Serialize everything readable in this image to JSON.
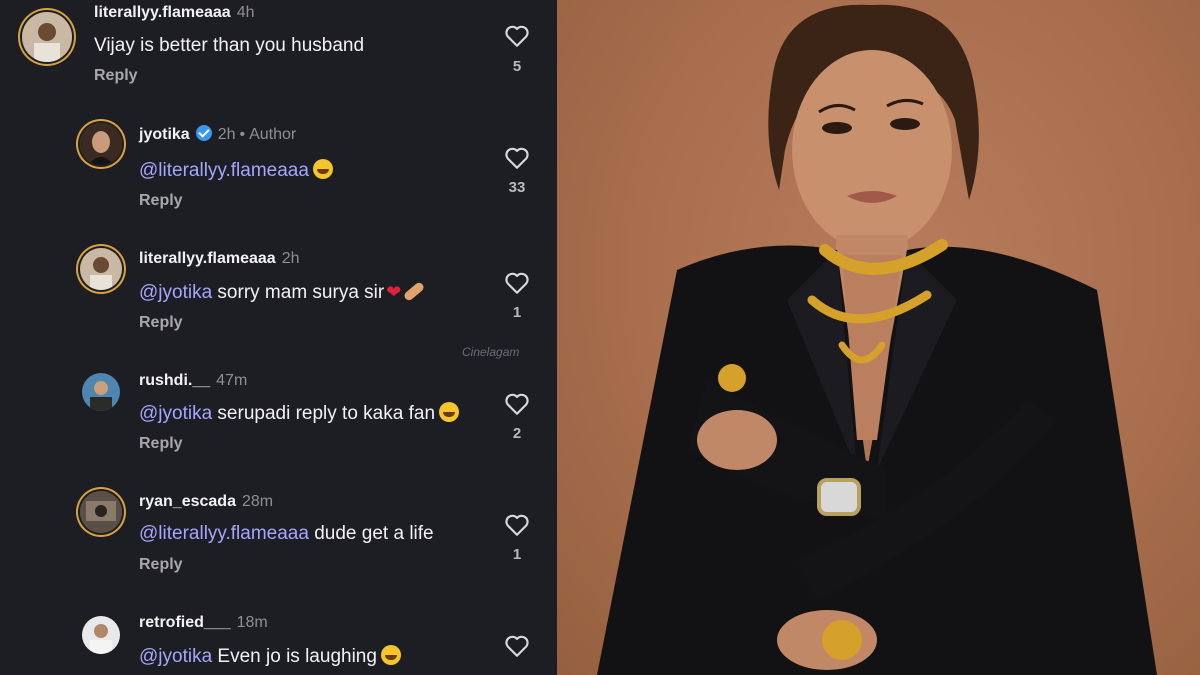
{
  "comments": [
    {
      "user": "literallyy.flameaaa",
      "time": "4h",
      "text": "Vijay is better than you husband",
      "mention": "",
      "reply": "Reply",
      "likes": "5",
      "author_tag": "",
      "verified": false,
      "emoji": ""
    },
    {
      "user": "jyotika",
      "time": "2h",
      "text": "",
      "mention": "@literallyy.flameaaa",
      "reply": "Reply",
      "likes": "33",
      "author_tag": "Author",
      "verified": true,
      "emoji": "😆"
    },
    {
      "user": "literallyy.flameaaa",
      "time": "2h",
      "text": " sorry mam  surya sir",
      "mention": "@jyotika",
      "reply": "Reply",
      "likes": "1",
      "author_tag": "",
      "verified": false,
      "emoji": "❤️🩹"
    },
    {
      "user": "rushdi.__",
      "time": "47m",
      "text": " serupadi reply to kaka fan",
      "mention": "@jyotika",
      "reply": "Reply",
      "likes": "2",
      "author_tag": "",
      "verified": false,
      "emoji": "😆"
    },
    {
      "user": "ryan_escada",
      "time": "28m",
      "text": " dude get a life",
      "mention": "@literallyy.flameaaa",
      "reply": "Reply",
      "likes": "1",
      "author_tag": "",
      "verified": false,
      "emoji": ""
    },
    {
      "user": "retrofied___",
      "time": "18m",
      "text": " Even jo is laughing",
      "mention": "@jyotika",
      "reply": "",
      "likes": "",
      "author_tag": "",
      "verified": false,
      "emoji": "🤣"
    }
  ],
  "watermark": "Cinelagam",
  "colors": {
    "panel_bg": "#1d1e24",
    "mention": "#a4a6ff",
    "photo_bg": "#a86e4e",
    "blazer": "#121214",
    "gold": "#d6a12a"
  }
}
